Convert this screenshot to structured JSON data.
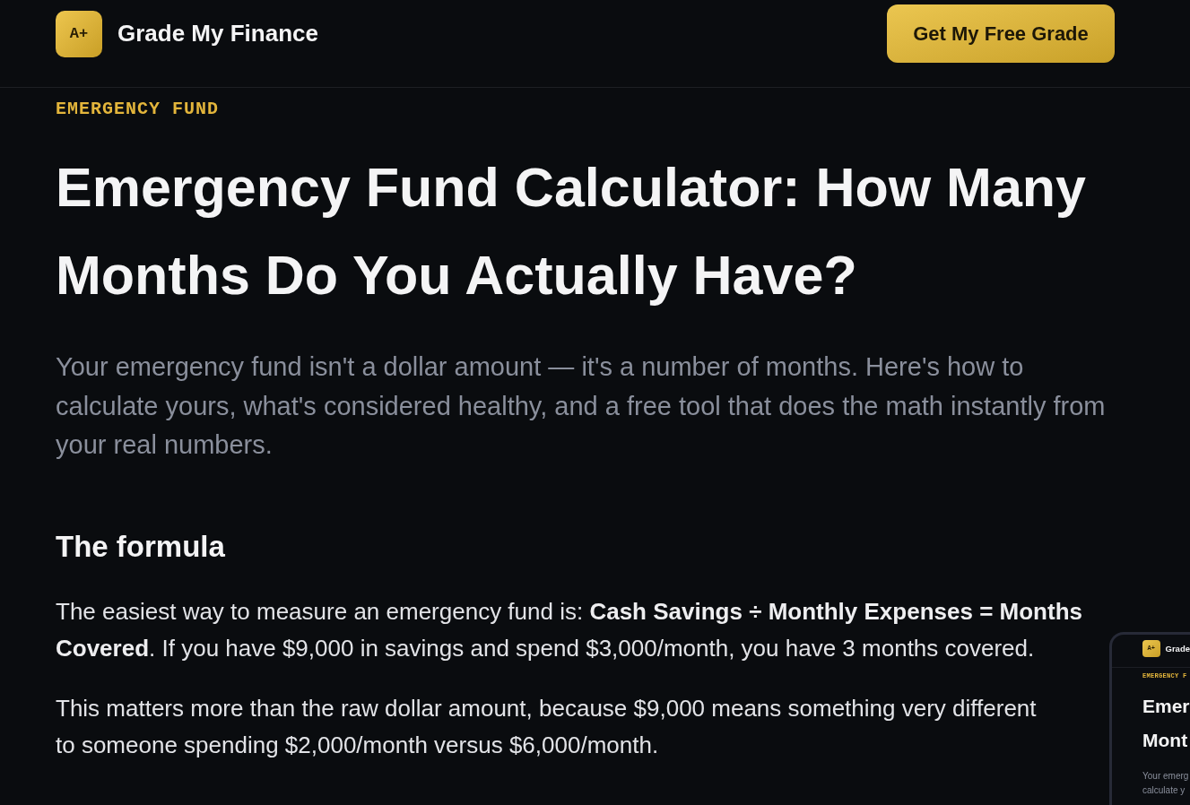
{
  "header": {
    "logo_badge": "A+",
    "brand": "Grade My Finance",
    "cta": "Get My Free Grade"
  },
  "article": {
    "eyebrow": "EMERGENCY FUND",
    "title": "Emergency Fund Calculator: How Many Months Do You Actually Have?",
    "intro": "Your emergency fund isn't a dollar amount — it's a number of months. Here's how to calculate yours, what's considered healthy, and a free tool that does the math instantly from your real numbers.",
    "sections": [
      {
        "heading": "The formula",
        "paragraphs": [
          "The easiest way to measure an emergency fund is: **Cash Savings ÷ Monthly Expenses = Months Covered**. If you have $9,000 in savings and spend $3,000/month, you have 3 months covered.",
          "This matters more than the raw dollar amount, because $9,000 means something very different to someone spending $2,000/month versus $6,000/month."
        ]
      }
    ]
  },
  "preview": {
    "logo_badge": "A+",
    "brand": "Grade",
    "eyebrow": "EMERGENCY F",
    "title_lines": [
      "Emer",
      "Mont"
    ],
    "intro_lines": [
      "Your emerg",
      "calculate y"
    ]
  }
}
